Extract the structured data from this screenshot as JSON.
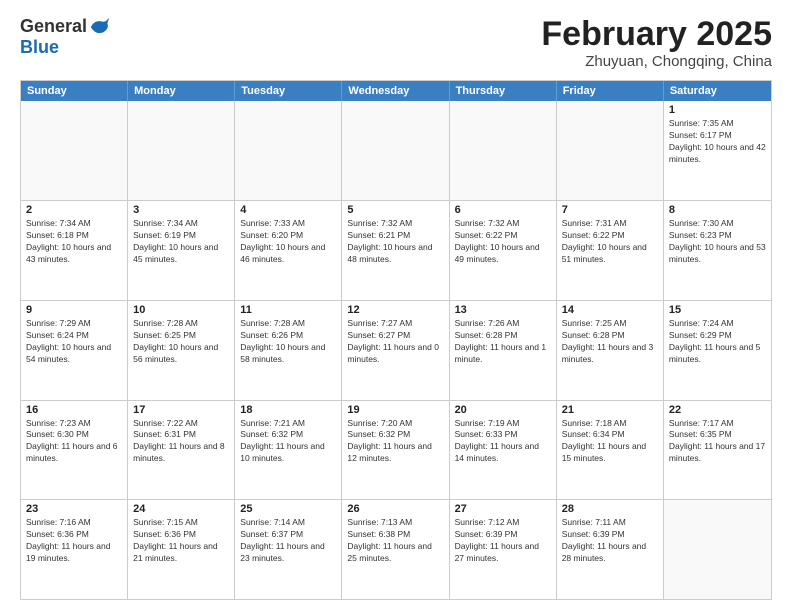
{
  "header": {
    "logo_general": "General",
    "logo_blue": "Blue",
    "month_title": "February 2025",
    "location": "Zhuyuan, Chongqing, China"
  },
  "days_of_week": [
    "Sunday",
    "Monday",
    "Tuesday",
    "Wednesday",
    "Thursday",
    "Friday",
    "Saturday"
  ],
  "rows": [
    {
      "cells": [
        {
          "day": "",
          "empty": true
        },
        {
          "day": "",
          "empty": true
        },
        {
          "day": "",
          "empty": true
        },
        {
          "day": "",
          "empty": true
        },
        {
          "day": "",
          "empty": true
        },
        {
          "day": "",
          "empty": true
        },
        {
          "day": "1",
          "sunrise": "Sunrise: 7:35 AM",
          "sunset": "Sunset: 6:17 PM",
          "daylight": "Daylight: 10 hours and 42 minutes."
        }
      ]
    },
    {
      "cells": [
        {
          "day": "2",
          "sunrise": "Sunrise: 7:34 AM",
          "sunset": "Sunset: 6:18 PM",
          "daylight": "Daylight: 10 hours and 43 minutes."
        },
        {
          "day": "3",
          "sunrise": "Sunrise: 7:34 AM",
          "sunset": "Sunset: 6:19 PM",
          "daylight": "Daylight: 10 hours and 45 minutes."
        },
        {
          "day": "4",
          "sunrise": "Sunrise: 7:33 AM",
          "sunset": "Sunset: 6:20 PM",
          "daylight": "Daylight: 10 hours and 46 minutes."
        },
        {
          "day": "5",
          "sunrise": "Sunrise: 7:32 AM",
          "sunset": "Sunset: 6:21 PM",
          "daylight": "Daylight: 10 hours and 48 minutes."
        },
        {
          "day": "6",
          "sunrise": "Sunrise: 7:32 AM",
          "sunset": "Sunset: 6:22 PM",
          "daylight": "Daylight: 10 hours and 49 minutes."
        },
        {
          "day": "7",
          "sunrise": "Sunrise: 7:31 AM",
          "sunset": "Sunset: 6:22 PM",
          "daylight": "Daylight: 10 hours and 51 minutes."
        },
        {
          "day": "8",
          "sunrise": "Sunrise: 7:30 AM",
          "sunset": "Sunset: 6:23 PM",
          "daylight": "Daylight: 10 hours and 53 minutes."
        }
      ]
    },
    {
      "cells": [
        {
          "day": "9",
          "sunrise": "Sunrise: 7:29 AM",
          "sunset": "Sunset: 6:24 PM",
          "daylight": "Daylight: 10 hours and 54 minutes."
        },
        {
          "day": "10",
          "sunrise": "Sunrise: 7:28 AM",
          "sunset": "Sunset: 6:25 PM",
          "daylight": "Daylight: 10 hours and 56 minutes."
        },
        {
          "day": "11",
          "sunrise": "Sunrise: 7:28 AM",
          "sunset": "Sunset: 6:26 PM",
          "daylight": "Daylight: 10 hours and 58 minutes."
        },
        {
          "day": "12",
          "sunrise": "Sunrise: 7:27 AM",
          "sunset": "Sunset: 6:27 PM",
          "daylight": "Daylight: 11 hours and 0 minutes."
        },
        {
          "day": "13",
          "sunrise": "Sunrise: 7:26 AM",
          "sunset": "Sunset: 6:28 PM",
          "daylight": "Daylight: 11 hours and 1 minute."
        },
        {
          "day": "14",
          "sunrise": "Sunrise: 7:25 AM",
          "sunset": "Sunset: 6:28 PM",
          "daylight": "Daylight: 11 hours and 3 minutes."
        },
        {
          "day": "15",
          "sunrise": "Sunrise: 7:24 AM",
          "sunset": "Sunset: 6:29 PM",
          "daylight": "Daylight: 11 hours and 5 minutes."
        }
      ]
    },
    {
      "cells": [
        {
          "day": "16",
          "sunrise": "Sunrise: 7:23 AM",
          "sunset": "Sunset: 6:30 PM",
          "daylight": "Daylight: 11 hours and 6 minutes."
        },
        {
          "day": "17",
          "sunrise": "Sunrise: 7:22 AM",
          "sunset": "Sunset: 6:31 PM",
          "daylight": "Daylight: 11 hours and 8 minutes."
        },
        {
          "day": "18",
          "sunrise": "Sunrise: 7:21 AM",
          "sunset": "Sunset: 6:32 PM",
          "daylight": "Daylight: 11 hours and 10 minutes."
        },
        {
          "day": "19",
          "sunrise": "Sunrise: 7:20 AM",
          "sunset": "Sunset: 6:32 PM",
          "daylight": "Daylight: 11 hours and 12 minutes."
        },
        {
          "day": "20",
          "sunrise": "Sunrise: 7:19 AM",
          "sunset": "Sunset: 6:33 PM",
          "daylight": "Daylight: 11 hours and 14 minutes."
        },
        {
          "day": "21",
          "sunrise": "Sunrise: 7:18 AM",
          "sunset": "Sunset: 6:34 PM",
          "daylight": "Daylight: 11 hours and 15 minutes."
        },
        {
          "day": "22",
          "sunrise": "Sunrise: 7:17 AM",
          "sunset": "Sunset: 6:35 PM",
          "daylight": "Daylight: 11 hours and 17 minutes."
        }
      ]
    },
    {
      "cells": [
        {
          "day": "23",
          "sunrise": "Sunrise: 7:16 AM",
          "sunset": "Sunset: 6:36 PM",
          "daylight": "Daylight: 11 hours and 19 minutes."
        },
        {
          "day": "24",
          "sunrise": "Sunrise: 7:15 AM",
          "sunset": "Sunset: 6:36 PM",
          "daylight": "Daylight: 11 hours and 21 minutes."
        },
        {
          "day": "25",
          "sunrise": "Sunrise: 7:14 AM",
          "sunset": "Sunset: 6:37 PM",
          "daylight": "Daylight: 11 hours and 23 minutes."
        },
        {
          "day": "26",
          "sunrise": "Sunrise: 7:13 AM",
          "sunset": "Sunset: 6:38 PM",
          "daylight": "Daylight: 11 hours and 25 minutes."
        },
        {
          "day": "27",
          "sunrise": "Sunrise: 7:12 AM",
          "sunset": "Sunset: 6:39 PM",
          "daylight": "Daylight: 11 hours and 27 minutes."
        },
        {
          "day": "28",
          "sunrise": "Sunrise: 7:11 AM",
          "sunset": "Sunset: 6:39 PM",
          "daylight": "Daylight: 11 hours and 28 minutes."
        },
        {
          "day": "",
          "empty": true
        }
      ]
    }
  ]
}
